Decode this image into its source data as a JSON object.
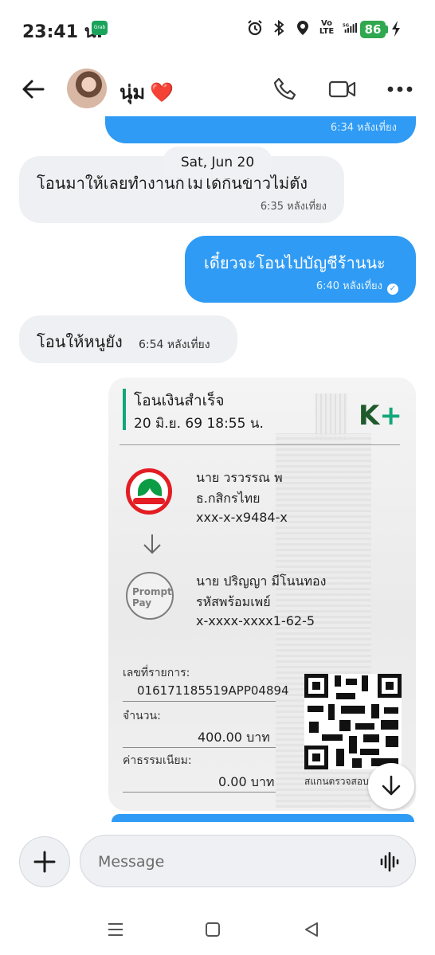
{
  "status_bar": {
    "time": "23:41 น.",
    "grab_label": "Grab",
    "volte": "Vo LTE",
    "network": "5G",
    "battery": "86"
  },
  "header": {
    "contact_name": "นุ่ม",
    "heart": "❤️",
    "icons": [
      "back-arrow-icon",
      "phone-icon",
      "video-icon",
      "more-icon"
    ]
  },
  "chat": {
    "date_separator": "Sat, Jun 20",
    "messages": [
      {
        "side": "out",
        "text": "",
        "time": "6:34 หลังเที่ยง"
      },
      {
        "side": "in",
        "text": "โอนมาให้เลยทำงานก็ไม่ได้กินข้าวไม่ตัง",
        "time": "6:35 หลังเที่ยง"
      },
      {
        "side": "out",
        "text": "เดี๋ยวจะโอนไปบัญชีร้านนะ",
        "time": "6:40 หลังเที่ยง"
      },
      {
        "side": "in",
        "text": "โอนให้หนูยัง",
        "time": "6:54 หลังเที่ยง"
      }
    ]
  },
  "slip": {
    "title": "โอนเงินสำเร็จ",
    "datetime": "20 มิ.ย. 69  18:55 น.",
    "brand": "K",
    "brand_plus": "+",
    "sender": {
      "name": "นาย วรวรรณ พ",
      "bank": "ธ.กสิกรไทย",
      "account": "xxx-x-x9484-x"
    },
    "receiver": {
      "name": "นาย ปริญญา มีโนนทอง",
      "bank": "รหัสพร้อมเพย์",
      "account": "x-xxxx-xxxx1-62-5",
      "logo_line1": "Prompt",
      "logo_line2": "Pay"
    },
    "ref_label": "เลขที่รายการ:",
    "ref_value": "016171185519APP04894",
    "amount_label": "จำนวน:",
    "amount_value": "400.00 บาท",
    "fee_label": "ค่าธรรมเนียม:",
    "fee_value": "0.00 บาท",
    "qr_caption": "สแกนตรวจสอบสลิป"
  },
  "composer": {
    "placeholder": "Message"
  },
  "colors": {
    "accent": "#2f9bf4",
    "incoming_bubble": "#eef0f3",
    "kbank_green": "#12a77a",
    "battery_green": "#2fa84f"
  }
}
